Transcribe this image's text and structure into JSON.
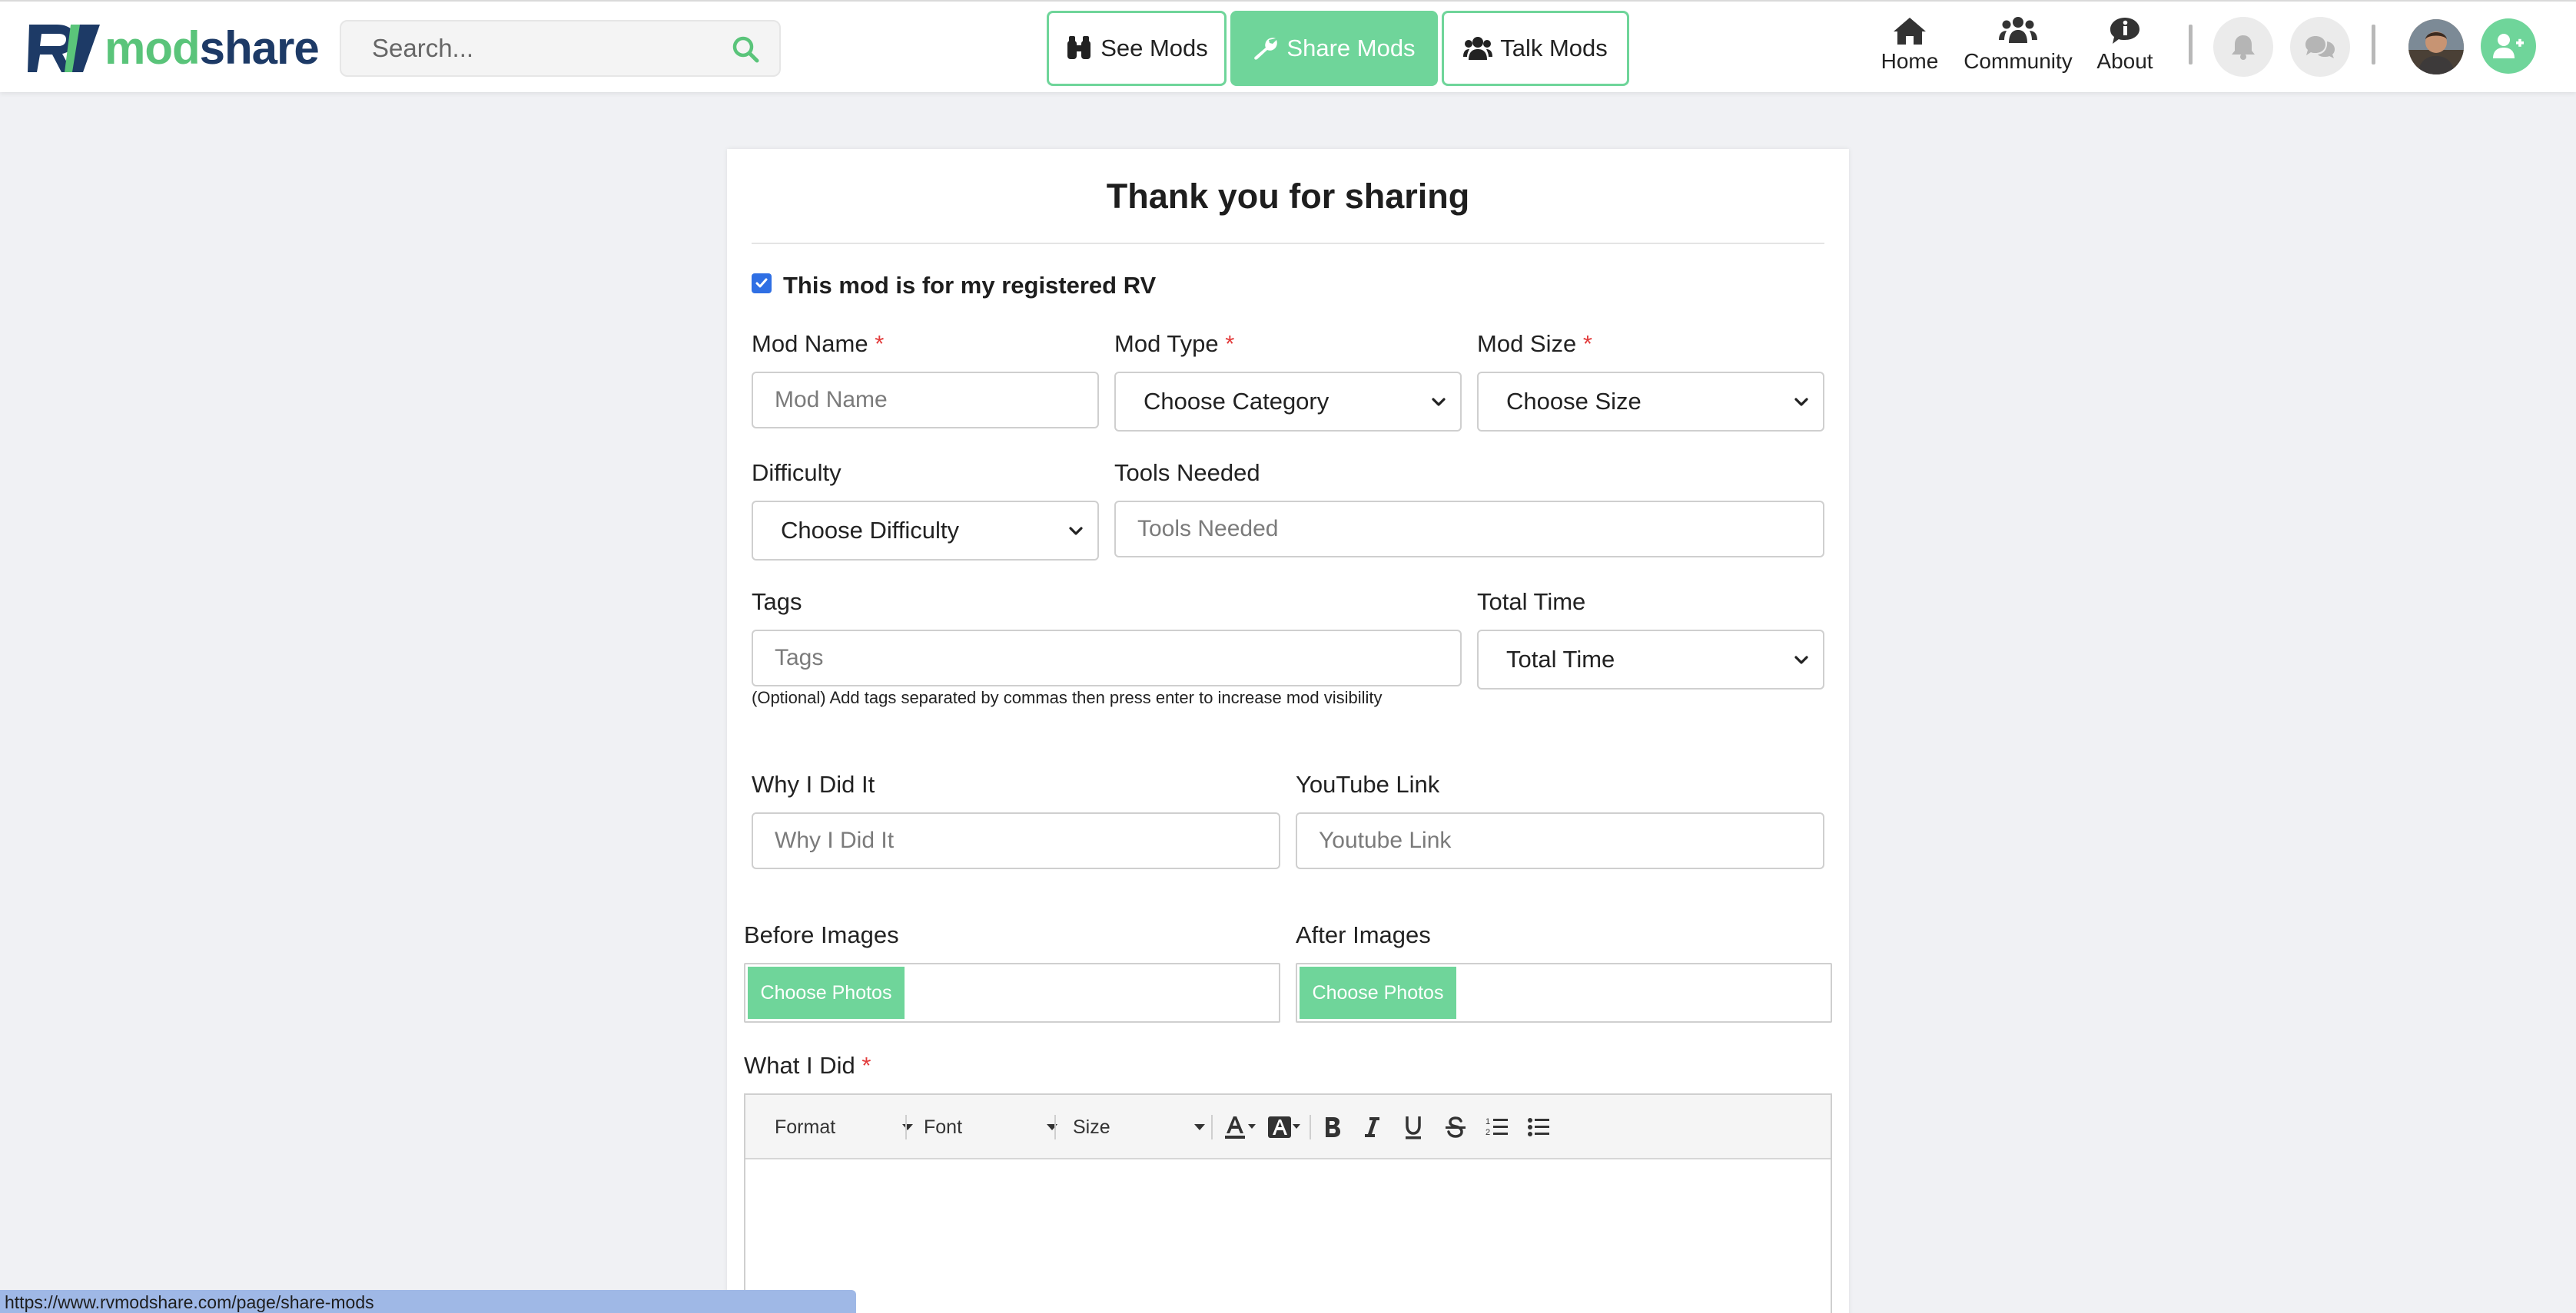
{
  "brand": {
    "prefix": "RV",
    "mod": "mod",
    "share": "share",
    "accent": "#6fd59a",
    "navy": "#1d3a66"
  },
  "search": {
    "placeholder": "Search..."
  },
  "nav_buttons": [
    {
      "label": "See Mods",
      "icon": "binoculars-icon"
    },
    {
      "label": "Share Mods",
      "icon": "wrench-icon",
      "active": true
    },
    {
      "label": "Talk Mods",
      "icon": "users-icon"
    }
  ],
  "top_nav": [
    {
      "label": "Home",
      "icon": "home-icon"
    },
    {
      "label": "Community",
      "icon": "community-icon"
    },
    {
      "label": "About",
      "icon": "info-icon"
    }
  ],
  "form": {
    "title": "Thank you for sharing",
    "registered_checkbox": {
      "label": "This mod is for my registered RV",
      "checked": true
    },
    "mod_name": {
      "label": "Mod Name",
      "required": "*",
      "placeholder": "Mod Name"
    },
    "mod_type": {
      "label": "Mod Type",
      "required": "*",
      "value": "Choose Category"
    },
    "mod_size": {
      "label": "Mod Size",
      "required": "*",
      "value": "Choose Size"
    },
    "difficulty": {
      "label": "Difficulty",
      "value": "Choose Difficulty"
    },
    "tools_needed": {
      "label": "Tools Needed",
      "placeholder": "Tools Needed"
    },
    "tags": {
      "label": "Tags",
      "placeholder": "Tags",
      "hint": "(Optional) Add tags separated by commas then press enter to increase mod visibility"
    },
    "total_time": {
      "label": "Total Time",
      "value": "Total Time"
    },
    "why": {
      "label": "Why I Did It",
      "placeholder": "Why I Did It"
    },
    "youtube": {
      "label": "YouTube Link",
      "placeholder": "Youtube Link"
    },
    "before_images": {
      "label": "Before Images",
      "button": "Choose Photos"
    },
    "after_images": {
      "label": "After Images",
      "button": "Choose Photos"
    },
    "what_i_did": {
      "label": "What I Did",
      "required": "*"
    },
    "editor_toolbar": {
      "format": "Format",
      "font": "Font",
      "size": "Size"
    }
  },
  "status_url": "https://www.rvmodshare.com/page/share-mods"
}
